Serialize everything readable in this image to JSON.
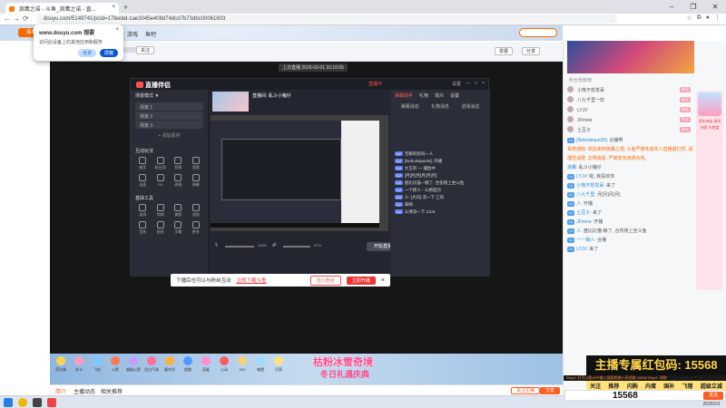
{
  "browser": {
    "tab_title": "浪鹰之诺 - 斗鱼_浪鹰之诺 - 直...",
    "tab_close": "×",
    "new_tab": "+",
    "url": "douyu.com/5149741/pcid=17feebd-1ae3045e408d74dcd7b73dbc00061603",
    "window_controls": [
      "–",
      "❐",
      "✕"
    ]
  },
  "permission_popup": {
    "site": "www.douyu.com 想要",
    "description": "访问此设备上的其他应用和服务",
    "allow_label": "允许",
    "block_label": "屏蔽",
    "close": "×"
  },
  "header": {
    "logo": "斗鱼",
    "nav": [
      "直播",
      "分类",
      "游戏",
      "鱼吧"
    ],
    "search_placeholder": "搜索"
  },
  "room": {
    "follow_label": "关注",
    "share_label": "分享",
    "report_label": "举报"
  },
  "video": {
    "badge": "上次直播 2026-02-01 15:10:05"
  },
  "streamer_app": {
    "title": "直播伴侣",
    "record_label": "直播中",
    "controls": [
      "设置",
      "—",
      "□",
      "×"
    ],
    "scene_header": "场景模式 ▼",
    "scenes": [
      "场景 1",
      "场景 2",
      "场景 3"
    ],
    "add_source": "+ 添加素材",
    "interaction_header": "互动玩法",
    "interaction_tiles": [
      "抽奖",
      "粉丝团",
      "投票",
      "竞猜",
      "连麦",
      "PK",
      "表情",
      "弹幕"
    ],
    "tools_header": "基础工具",
    "tool_tiles": [
      "录屏",
      "剪辑",
      "美颜",
      "滤镜",
      "音效",
      "贴纸",
      "字幕",
      "更多"
    ],
    "room_name": "直播间: 乱斗小猪仔",
    "volume_mic": "100%",
    "volume_speaker": "51%",
    "start_label": "开始直播",
    "chat_tabs": [
      "弹幕助手",
      "礼物",
      "观众",
      "设置"
    ],
    "assist_tabs": [
      "弹幕消息",
      "礼物消息",
      "进场消息"
    ],
    "chat_lines": [
      "无聊的狗叫一人",
      "[Nebulsique26]: 开播",
      "大王的 一 捕鱼中",
      "[月]月]月]月]月]月]",
      "盘比比猫—鲸了, 合伤夜上坐斗鱼",
      "一个蹄人 - 么想成功",
      "人: [大日] 凉一下 乙的",
      "来啊",
      "么弹凉一下 1/1/4"
    ]
  },
  "notice_bar": {
    "text": "下播后也可以与粉丝互动",
    "download": "立即下载斗鱼",
    "btn1": "加入粉丝",
    "btn2": "立即开播",
    "close": "×"
  },
  "gift_bar": {
    "gifts": [
      "荧光棒",
      "办卡",
      "飞机",
      "火箭",
      "超级火箭",
      "告白气球",
      "嘉年华",
      "超跑",
      "宠爱",
      "心动",
      "520",
      "城堡",
      "月亮"
    ],
    "banner_line1": "枯粉冰雪奇境",
    "banner_line2": "冬日礼遇庆典"
  },
  "page_tabs": {
    "tabs": [
      "简介",
      "主播动态",
      "相关推荐"
    ],
    "follow_btn": "关注主播",
    "share_btn": "分享"
  },
  "sidebar": {
    "rank_title": "粉丝贡献榜",
    "rank_rows": [
      {
        "name": "小熊不想发呆",
        "tag": "粉丝"
      },
      {
        "name": "八九千里一样",
        "tag": "粉丝"
      },
      {
        "name": "LYJV",
        "tag": "粉丝"
      },
      {
        "name": "JFmine",
        "tag": "粉丝"
      },
      {
        "name": "土豆子",
        "tag": "粉丝"
      }
    ],
    "chat": [
      {
        "user": "[Nebulsique26]:",
        "text": "合播啊"
      },
      {
        "user": "系统通知:",
        "text": "欢迎来到浪鹰之诺, 斗鱼严禁未成年人直播或打赏, 请理性消费, 文明观看, 严禁发布违规内容。"
      },
      {
        "user": "浪鹰:",
        "text": "乱斗小猪仔"
      },
      {
        "user": "LYJV:",
        "text": "啦, 我喜欢你"
      },
      {
        "user": "小熊不想发呆:",
        "text": "来了"
      },
      {
        "user": "八九千里:",
        "text": "月]月]月]月]"
      },
      {
        "user": "人:",
        "text": "开播"
      },
      {
        "user": "土豆子:",
        "text": "来了"
      },
      {
        "user": "JFmine:",
        "text": "开播"
      },
      {
        "user": "人:",
        "text": "盘比比猫-鲸了, 合伤夜上坐斗鱼"
      },
      {
        "user": "一一弹人:",
        "text": "合播"
      },
      {
        "user": "LYJV:",
        "text": "来了"
      }
    ],
    "promo_text": "龙年夹娃 乘风 许愿 大转盘"
  },
  "overlay": {
    "headline": "主播专属红包码: 15568",
    "subline": "Step1: 打开斗鱼APP输入搜索框输入码领取 15568 Step2: 领取",
    "tags": [
      "关注",
      "推荐",
      "闪购",
      "内蛋",
      "国补",
      "飞猪",
      "超级立减"
    ],
    "code": "15568",
    "send": "发送"
  },
  "taskbar": {
    "time": "15:47",
    "date": "2026/2/1"
  }
}
